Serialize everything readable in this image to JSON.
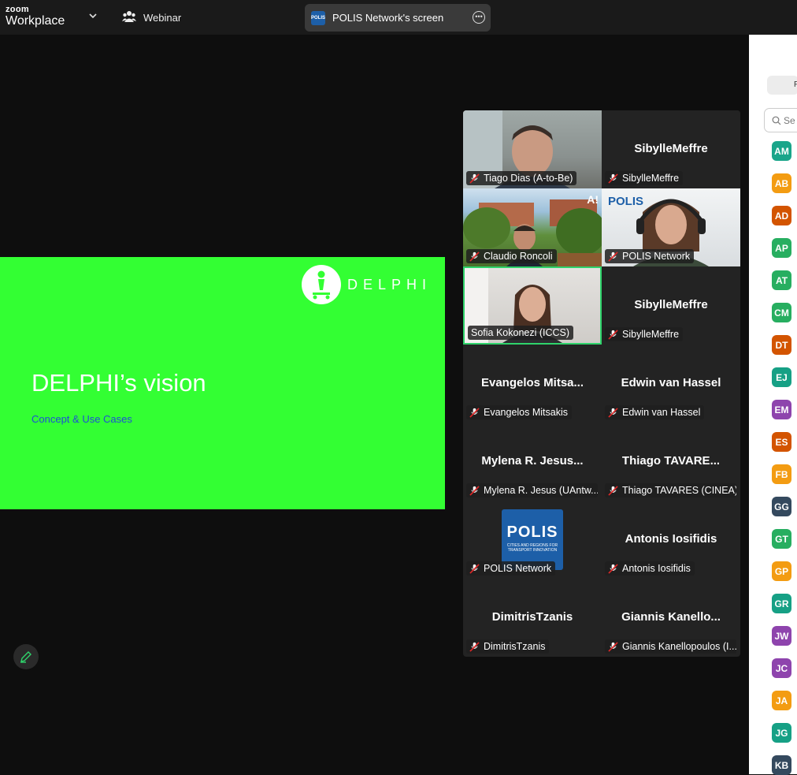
{
  "topbar": {
    "logo_line1": "zoom",
    "logo_line2": "Workplace",
    "webinar_label": "Webinar",
    "share_label": "POLIS Network's screen",
    "share_icon_text": "POLIS"
  },
  "slide": {
    "logo_word": "DELPHI",
    "title": "DELPHI’s vision",
    "subtitle": "Concept & Use Cases",
    "bg_color": "#33ff33"
  },
  "participants": [
    {
      "tag": "Tiago Dias (A-to-Be)",
      "big": ""
    },
    {
      "tag": "SibylleMeffre",
      "big": "SibylleMeffre"
    },
    {
      "tag": "Claudio Roncoli",
      "big": ""
    },
    {
      "tag": "POLIS Network",
      "big": ""
    },
    {
      "tag": "Sofia Kokonezi (ICCS)",
      "big": ""
    },
    {
      "tag": "SibylleMeffre",
      "big": "SibylleMeffre"
    },
    {
      "tag": "Evangelos Mitsakis",
      "big": "Evangelos  Mitsa..."
    },
    {
      "tag": "Edwin van Hassel",
      "big": "Edwin van Hassel"
    },
    {
      "tag": "Mylena R. Jesus (UAntw...",
      "big": "Mylena R. Jesus..."
    },
    {
      "tag": "Thiago TAVARES (CINEA)",
      "big": "Thiago  TAVARE..."
    },
    {
      "tag": "POLIS Network",
      "big": ""
    },
    {
      "tag": "Antonis Iosifidis",
      "big": "Antonis Iosifidis"
    },
    {
      "tag": "DimitrisTzanis",
      "big": "DimitrisTzanis"
    },
    {
      "tag": "Giannis Kanellopoulos (I...",
      "big": "Giannis  Kanello..."
    }
  ],
  "tile_extras": {
    "ai_badge": "A!",
    "polis_banner": "POLIS",
    "polis_logo_main": "POLIS",
    "polis_logo_sub1": "CITIES AND REGIONS FOR",
    "polis_logo_sub2": "TRANSPORT INNOVATION"
  },
  "right_panel": {
    "tab_label": "P",
    "search_placeholder": "Se",
    "avatars": [
      {
        "initials": "AM",
        "color": "#1aa58a"
      },
      {
        "initials": "AB",
        "color": "#f39c12"
      },
      {
        "initials": "AD",
        "color": "#d35400"
      },
      {
        "initials": "AP",
        "color": "#27ae60"
      },
      {
        "initials": "AT",
        "color": "#27ae60"
      },
      {
        "initials": "CM",
        "color": "#27ae60"
      },
      {
        "initials": "DT",
        "color": "#d35400"
      },
      {
        "initials": "EJ",
        "color": "#16a085"
      },
      {
        "initials": "EM",
        "color": "#8e44ad"
      },
      {
        "initials": "ES",
        "color": "#d35400"
      },
      {
        "initials": "FB",
        "color": "#f39c12"
      },
      {
        "initials": "GG",
        "color": "#34495e"
      },
      {
        "initials": "GT",
        "color": "#27ae60"
      },
      {
        "initials": "GP",
        "color": "#f39c12"
      },
      {
        "initials": "GR",
        "color": "#16a085"
      },
      {
        "initials": "JW",
        "color": "#8e44ad"
      },
      {
        "initials": "JC",
        "color": "#8e44ad"
      },
      {
        "initials": "JA",
        "color": "#f39c12"
      },
      {
        "initials": "JG",
        "color": "#16a085"
      },
      {
        "initials": "KB",
        "color": "#34495e"
      }
    ]
  }
}
